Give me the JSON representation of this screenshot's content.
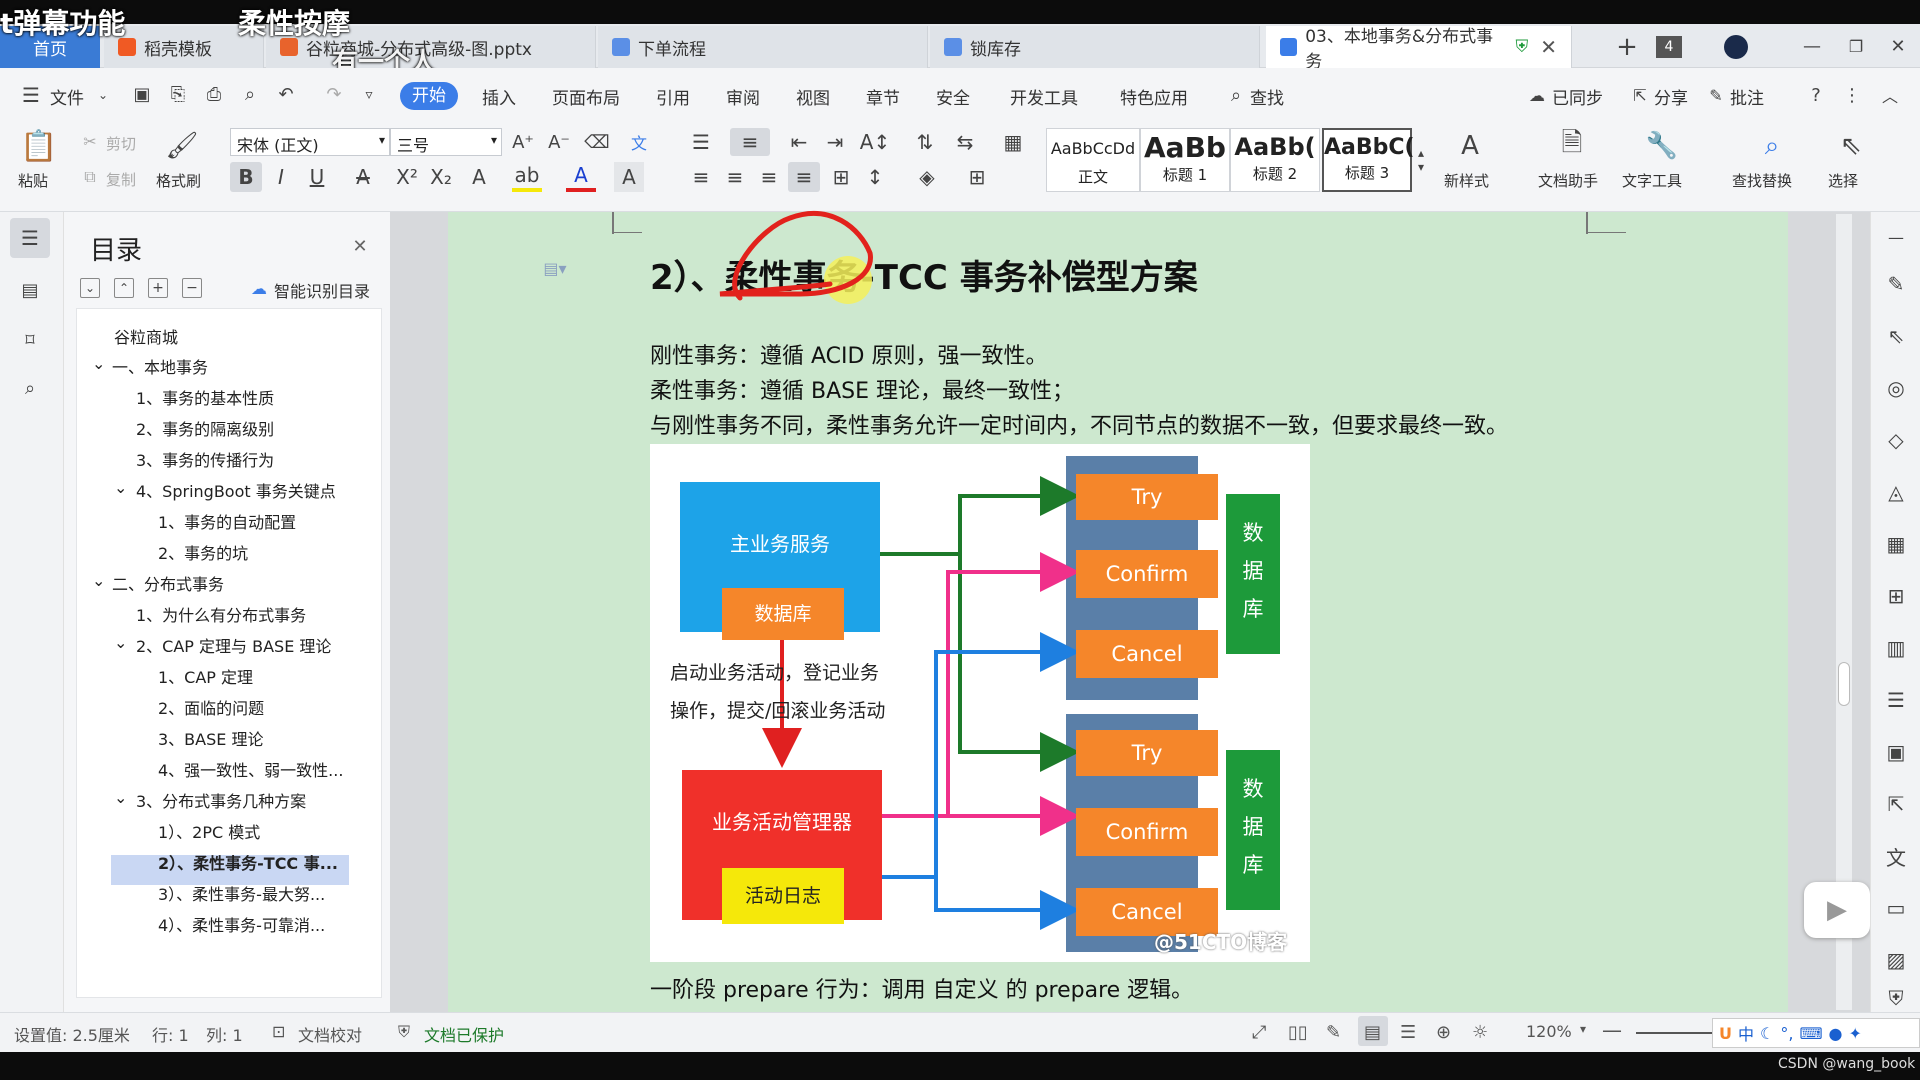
{
  "overlay": {
    "danmaku": "t弹幕功能",
    "massage": "柔性按摩",
    "someone": "有一个人"
  },
  "tabs": {
    "home": "首页",
    "items": [
      "稻壳模板",
      "谷粒商城-分布式高级-图.pptx",
      "下单流程",
      "锁库存",
      "03、本地事务&分布式事务"
    ],
    "tab_count": "4"
  },
  "menu": {
    "file": "文件",
    "items": [
      "开始",
      "插入",
      "页面布局",
      "引用",
      "审阅",
      "视图",
      "章节",
      "安全",
      "开发工具",
      "特色应用"
    ],
    "search": "查找",
    "synced": "已同步",
    "share": "分享",
    "comment": "批注"
  },
  "ribbon": {
    "paste": "粘贴",
    "cut": "剪切",
    "copy": "复制",
    "format_painter": "格式刷",
    "font_name": "宋体 (正文)",
    "font_size": "三号",
    "styles": [
      {
        "preview": "AaBbCcDd",
        "name": "正文"
      },
      {
        "preview": "AaBb",
        "name": "标题 1"
      },
      {
        "preview": "AaBb(",
        "name": "标题 2"
      },
      {
        "preview": "AaBbC(",
        "name": "标题 3"
      }
    ],
    "new_style": "新样式",
    "doc_helper": "文档助手",
    "text_tools": "文字工具",
    "find_replace": "查找替换",
    "select": "选择"
  },
  "toc": {
    "title": "目录",
    "smart": "智能识别目录",
    "items": [
      "谷粒商城",
      "一、本地事务",
      "1、事务的基本性质",
      "2、事务的隔离级别",
      "3、事务的传播行为",
      "4、SpringBoot 事务关键点",
      "1、事务的自动配置",
      "2、事务的坑",
      "二、分布式事务",
      "1、为什么有分布式事务",
      "2、CAP 定理与 BASE 理论",
      "1、CAP 定理",
      "2、面临的问题",
      "3、BASE 理论",
      "4、强一致性、弱一致性...",
      "3、分布式事务几种方案",
      "1）、2PC 模式",
      "2）、柔性事务-TCC 事...",
      "3）、柔性事务-最大努...",
      "4）、柔性事务-可靠消..."
    ]
  },
  "doc": {
    "heading": "2）、柔性事务-TCC 事务补偿型方案",
    "p1": "刚性事务：遵循 ACID 原则，强一致性。",
    "p2": "柔性事务：遵循 BASE 理论，最终一致性；",
    "p3": "与刚性事务不同，柔性事务允许一定时间内，不同节点的数据不一致，但要求最终一致。",
    "p4": "一阶段 prepare 行为：调用 自定义 的 prepare 逻辑。"
  },
  "diagram": {
    "main_service": "主业务服务",
    "db": "数据库",
    "start_text1": "启动业务活动，登记业务",
    "start_text2": "操作，提交/回滚业务活动",
    "manager": "业务活动管理器",
    "log": "活动日志",
    "try": "Try",
    "confirm": "Confirm",
    "cancel": "Cancel",
    "db_vertical": [
      "数",
      "据",
      "库"
    ],
    "watermark": "@51CTO博客"
  },
  "status": {
    "setting": "设置值: 2.5厘米",
    "row": "行: 1",
    "col": "列: 1",
    "proof": "文档校对",
    "protected": "文档已保护",
    "zoom": "120%",
    "csdn": "CSDN @wang_book"
  },
  "colors": {
    "accent": "#3b7de8",
    "page": "#cde8cf",
    "blue": "#1da3e8",
    "orange": "#f5862a",
    "green": "#1d9a3a",
    "red": "#f0302a",
    "yellow": "#f5e80a",
    "slate": "#5a7fa8"
  }
}
